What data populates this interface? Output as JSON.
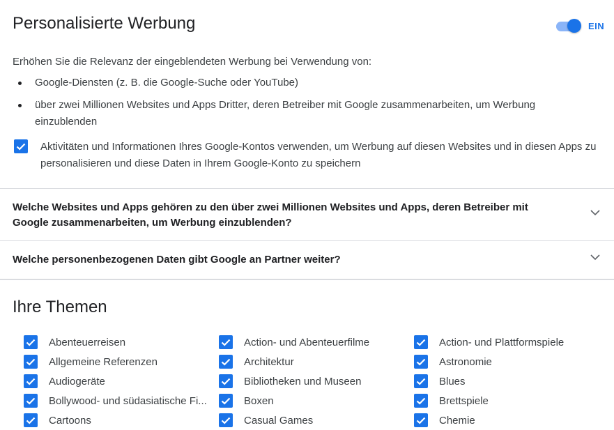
{
  "header": {
    "title": "Personalisierte Werbung",
    "toggle_label": "EIN",
    "toggle_on": true
  },
  "intro": "Erhöhen Sie die Relevanz der eingeblendeten Werbung bei Verwendung von:",
  "bullets": [
    "Google-Diensten (z. B. die Google-Suche oder YouTube)",
    "über zwei Millionen Websites und Apps Dritter, deren Betreiber mit Google zusammenarbeiten, um Werbung einzublenden"
  ],
  "consent": {
    "checked": true,
    "text": "Aktivitäten und Informationen Ihres Google-Kontos verwenden, um Werbung auf diesen Websites und in diesen Apps zu personalisieren und diese Daten in Ihrem Google-Konto zu speichern"
  },
  "faqs": [
    "Welche Websites und Apps gehören zu den über zwei Millionen Websites und Apps, deren Betreiber mit Google zusammenarbeiten, um Werbung einzublenden?",
    "Welche personenbezogenen Daten gibt Google an Partner weiter?"
  ],
  "topics": {
    "title": "Ihre Themen",
    "items": [
      "Abenteuerreisen",
      "Action- und Abenteuerfilme",
      "Action- und Plattformspiele",
      "Allgemeine Referenzen",
      "Architektur",
      "Astronomie",
      "Audiogeräte",
      "Bibliotheken und Museen",
      "Blues",
      "Bollywood- und südasiatische Fi...",
      "Boxen",
      "Brettspiele",
      "Cartoons",
      "Casual Games",
      "Chemie"
    ]
  },
  "colors": {
    "accent": "#1a73e8",
    "divider": "#dadce0"
  }
}
